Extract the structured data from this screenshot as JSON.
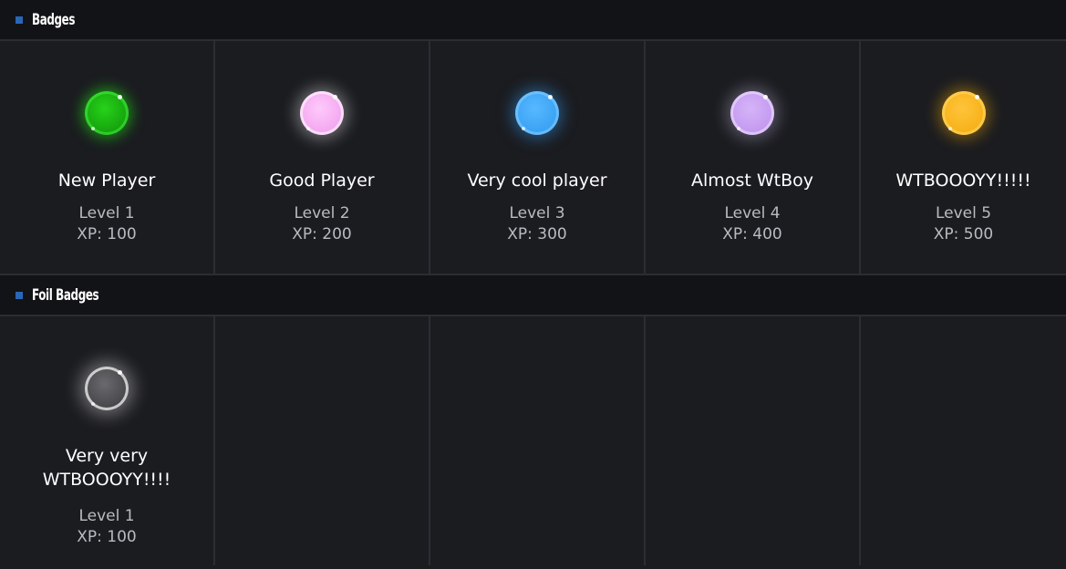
{
  "sections": {
    "badges": {
      "title": "Badges",
      "items": [
        {
          "name": "New Player",
          "level": "Level 1",
          "xp": "XP: 100",
          "color": "#18b80f",
          "glow": "#1fd613"
        },
        {
          "name": "Good Player",
          "level": "Level 2",
          "xp": "XP: 200",
          "color": "#f3a8f0",
          "glow": "#ffffff"
        },
        {
          "name": "Very cool player",
          "level": "Level 3",
          "xp": "XP: 300",
          "color": "#3aa3f4",
          "glow": "#2f8fe0"
        },
        {
          "name": "Almost WtBoy",
          "level": "Level 4",
          "xp": "XP: 400",
          "color": "#c49af0",
          "glow": "#e2d4ff"
        },
        {
          "name": "WTBOOOYY!!!!!",
          "level": "Level 5",
          "xp": "XP: 500",
          "color": "#f7b21a",
          "glow": "#f2a800"
        }
      ]
    },
    "foil": {
      "title": "Foil Badges",
      "items": [
        {
          "name": "Very very WTBOOOYY!!!!",
          "level": "Level 1",
          "xp": "XP: 100",
          "color": "#5a5a5e",
          "glow": "#ffffff"
        }
      ]
    }
  },
  "accent_color": "#2a66b8"
}
